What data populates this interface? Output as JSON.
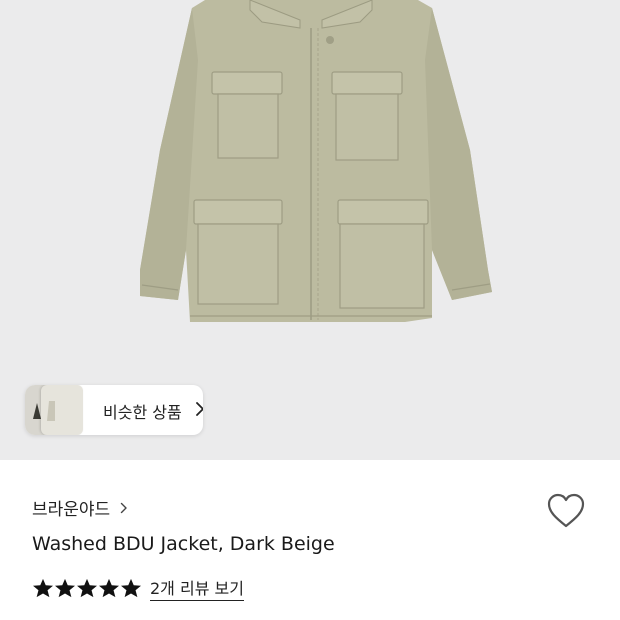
{
  "similar_products": {
    "label": "비슷한 상품"
  },
  "brand": {
    "name": "브라운야드"
  },
  "product": {
    "title": "Washed BDU Jacket, Dark Beige"
  },
  "rating": {
    "stars": 5,
    "max_stars": 5,
    "review_link": "2개 리뷰 보기"
  },
  "icons": [
    "chevron-right-icon",
    "heart-icon",
    "star-icon"
  ],
  "colors": {
    "image_bg": "#ebebec",
    "jacket": "#bcbba0",
    "text": "#222222"
  }
}
